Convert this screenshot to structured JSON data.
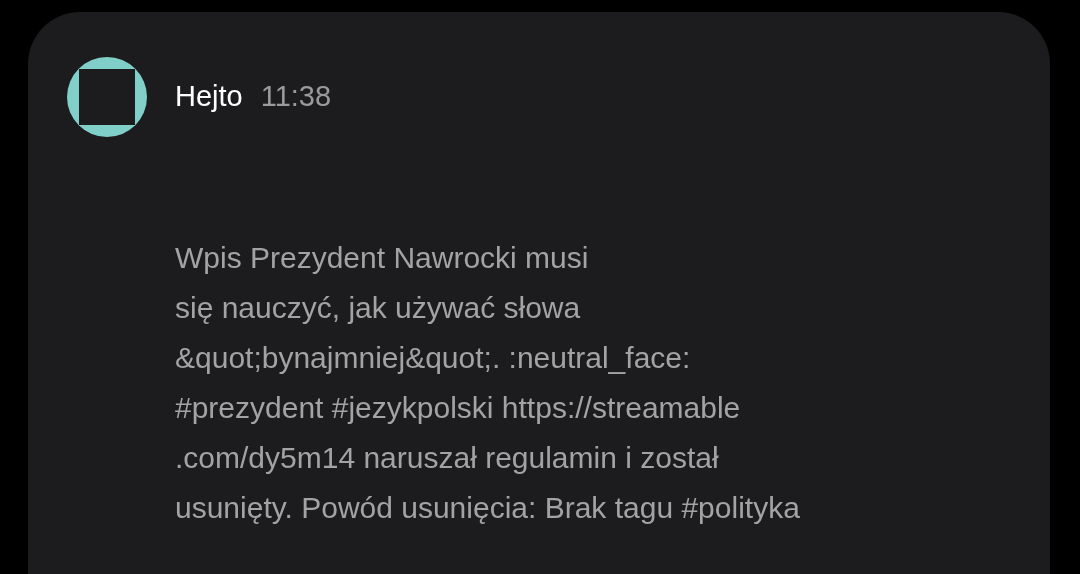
{
  "notification": {
    "app_name": "Hejto",
    "time": "11:38",
    "message": "Wpis Prezydent Nawrocki musi\nsię nauczyć, jak używać słowa\n&quot;bynajmniej&quot;. :neutral_face:\n#prezydent #jezykpolski https://streamable\n.com/dy5m14 naruszał regulamin i został\nusunięty. Powód usunięcia: Brak tagu #polityka"
  }
}
